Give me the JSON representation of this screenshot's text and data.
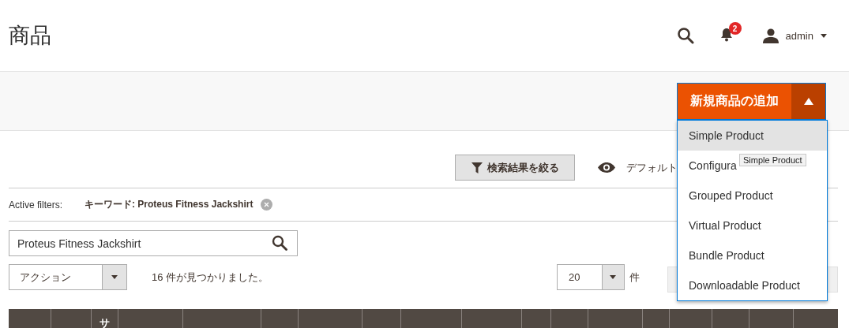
{
  "page_title": "商品",
  "header": {
    "notifications_count": "2",
    "user": "admin"
  },
  "add_button": {
    "label": "新規商品の追加",
    "expanded": true
  },
  "product_types": [
    {
      "label": "Simple Product",
      "selected": true
    },
    {
      "label": "Configura",
      "selected": false
    },
    {
      "label": "Grouped Product",
      "selected": false
    },
    {
      "label": "Virtual Product",
      "selected": false
    },
    {
      "label": "Bundle Product",
      "selected": false
    },
    {
      "label": "Downloadable Product",
      "selected": false
    }
  ],
  "tooltip": "Simple Product",
  "filters_button": "検索結果を絞る",
  "view_button": "デフォルト",
  "active_filters": {
    "label": "Active filters:",
    "filter": "キーワード: Proteus Fitness Jackshirt"
  },
  "search": {
    "value": "Proteus Fitness Jackshirt"
  },
  "actions": {
    "value": "アクション"
  },
  "records_found": "16 件が見つかりました。",
  "per_page": {
    "value": "20",
    "unit": "件"
  },
  "table": {
    "columns": [
      {},
      {},
      {
        "label": "サ"
      },
      {},
      {},
      {},
      {},
      {},
      {},
      {},
      {},
      {},
      {},
      {},
      {},
      {},
      {},
      {}
    ]
  }
}
